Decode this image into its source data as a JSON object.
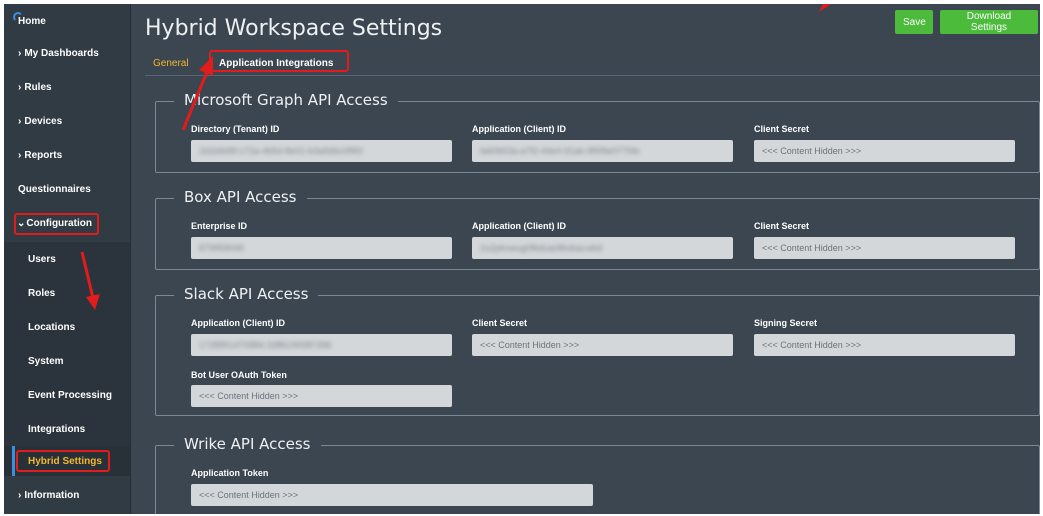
{
  "sidebar": {
    "items": [
      {
        "label": "Home",
        "chevron": ""
      },
      {
        "label": "My Dashboards",
        "chevron": "›"
      },
      {
        "label": "Rules",
        "chevron": "›"
      },
      {
        "label": "Devices",
        "chevron": "›"
      },
      {
        "label": "Reports",
        "chevron": "›"
      },
      {
        "label": "Questionnaires",
        "chevron": ""
      },
      {
        "label": "Configuration",
        "chevron": "⌄"
      },
      {
        "label": "Users",
        "chevron": ""
      },
      {
        "label": "Roles",
        "chevron": ""
      },
      {
        "label": "Locations",
        "chevron": ""
      },
      {
        "label": "System",
        "chevron": ""
      },
      {
        "label": "Event Processing",
        "chevron": ""
      },
      {
        "label": "Integrations",
        "chevron": ""
      },
      {
        "label": "Hybrid Settings",
        "chevron": ""
      },
      {
        "label": "Information",
        "chevron": "›"
      }
    ]
  },
  "header": {
    "title": "Hybrid Workspace Settings",
    "save_label": "Save",
    "download_label": "Download Settings"
  },
  "tabs": [
    {
      "label": "General"
    },
    {
      "label": "Application Integrations"
    }
  ],
  "sections": {
    "microsoft": {
      "title": "Microsoft Graph API Access",
      "fields": [
        {
          "label": "Directory (Tenant) ID",
          "value": "2d1b6d9f-c72a-4b5d-8e01-b3a9d6c0f9f3"
        },
        {
          "label": "Application (Client) ID",
          "value": "fa60b53a-a7f2-44e4-91ab-9f5f9e077f4b"
        },
        {
          "label": "Client Secret",
          "placeholder": "<<< Content Hidden >>>"
        }
      ]
    },
    "box": {
      "title": "Box API Access",
      "fields": [
        {
          "label": "Enterprise ID",
          "value": "879959049"
        },
        {
          "label": "Application (Client) ID",
          "value": "2u2pknwug0fkdcas9bxkacukid"
        },
        {
          "label": "Client Secret",
          "placeholder": "<<< Content Hidden >>>"
        }
      ]
    },
    "slack": {
      "title": "Slack API Access",
      "fields": [
        {
          "label": "Application (Client) ID",
          "value": "1728951470884.3386190087396"
        },
        {
          "label": "Client Secret",
          "placeholder": "<<< Content Hidden >>>"
        },
        {
          "label": "Signing Secret",
          "placeholder": "<<< Content Hidden >>>"
        },
        {
          "label": "Bot User OAuth Token",
          "placeholder": "<<< Content Hidden >>>"
        }
      ]
    },
    "wrike": {
      "title": "Wrike API Access",
      "fields": [
        {
          "label": "Application Token",
          "placeholder": "<<< Content Hidden >>>"
        }
      ]
    }
  },
  "colors": {
    "accent_green": "#4cbb3c",
    "active_tab": "#f2b632",
    "highlight_red": "#e21b1b",
    "background": "#3b4650"
  }
}
